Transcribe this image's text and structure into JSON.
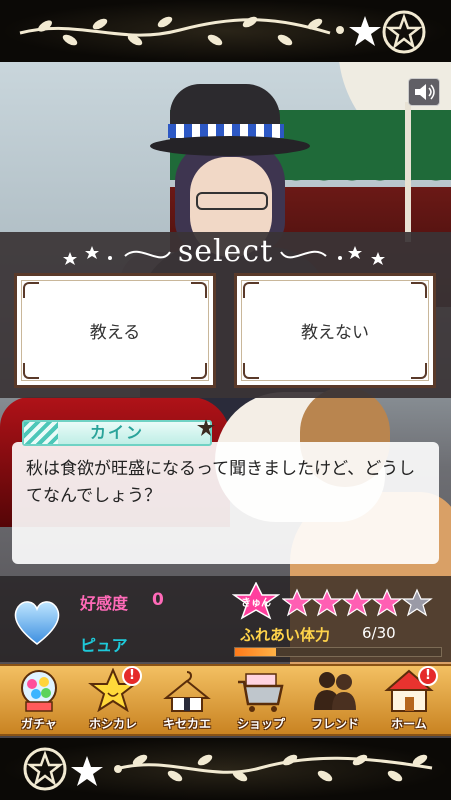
{
  "select": {
    "title": "select",
    "choices": [
      {
        "label": "教える"
      },
      {
        "label": "教えない"
      }
    ]
  },
  "dialogue": {
    "speaker": "カイン",
    "text": "秋は食欲が旺盛になるって聞きましたけど、どうしてなんでしょう？"
  },
  "status": {
    "affinity_label": "好感度",
    "affinity_value": "0",
    "heart_type_label": "ピュア",
    "kyun_label": "きゅん",
    "kyun_stars_filled": 4,
    "kyun_stars_total": 5,
    "stamina_label": "ふれあい体力",
    "stamina_value": "6/30",
    "stamina_fraction": 0.2
  },
  "nav": {
    "items": [
      {
        "label": "ガチャ",
        "icon": "gachapon-icon",
        "badge": false
      },
      {
        "label": "ホシカレ",
        "icon": "star-icon",
        "badge": true
      },
      {
        "label": "キセカエ",
        "icon": "hanger-icon",
        "badge": false
      },
      {
        "label": "ショップ",
        "icon": "cart-icon",
        "badge": false
      },
      {
        "label": "フレンド",
        "icon": "friends-icon",
        "badge": false
      },
      {
        "label": "ホーム",
        "icon": "house-icon",
        "badge": true
      }
    ],
    "badge_text": "!"
  },
  "colors": {
    "affinity": "#ff6ab8",
    "pure": "#1ec9d9",
    "name_tag": "#2aa39a",
    "star_filled": "#ff5fb3",
    "star_empty": "#9a9aa6",
    "nav_bg": "#e5a444"
  }
}
